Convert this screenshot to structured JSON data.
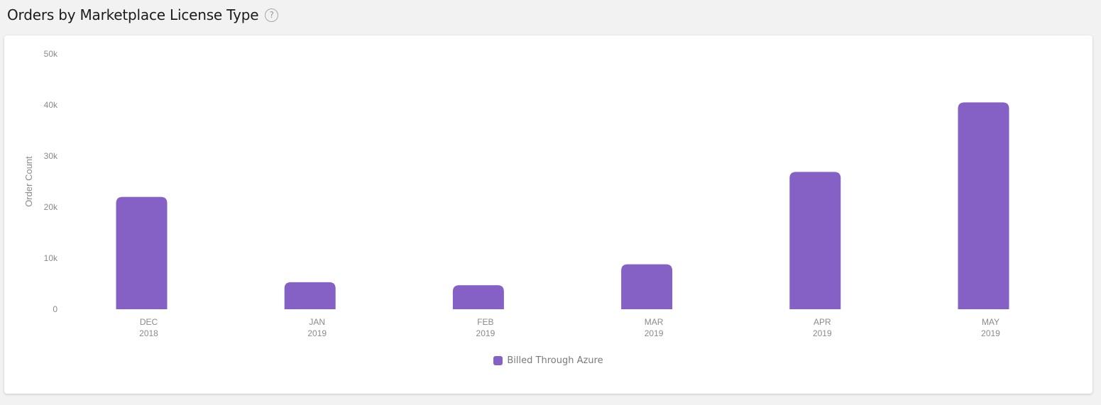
{
  "header": {
    "title": "Orders by Marketplace License Type",
    "help_icon": "question-circle-icon",
    "help_glyph": "?"
  },
  "colors": {
    "bar": "#8561c5",
    "axis_text": "#8a8a8a",
    "background": "#f2f2f2",
    "card": "#ffffff"
  },
  "chart_data": {
    "type": "bar",
    "categories": [
      [
        "DEC",
        "2018"
      ],
      [
        "JAN",
        "2019"
      ],
      [
        "FEB",
        "2019"
      ],
      [
        "MAR",
        "2019"
      ],
      [
        "APR",
        "2019"
      ],
      [
        "MAY",
        "2019"
      ]
    ],
    "series": [
      {
        "name": "Billed Through Azure",
        "values": [
          22000,
          5300,
          4700,
          8800,
          26900,
          40500
        ]
      }
    ],
    "ylabel": "Order Count",
    "ylim": [
      0,
      50000
    ],
    "yticks": [
      0,
      10000,
      20000,
      30000,
      40000,
      50000
    ],
    "ytick_labels": [
      "0",
      "10k",
      "20k",
      "30k",
      "40k",
      "50k"
    ],
    "grid": false,
    "legend_position": "bottom-center"
  }
}
